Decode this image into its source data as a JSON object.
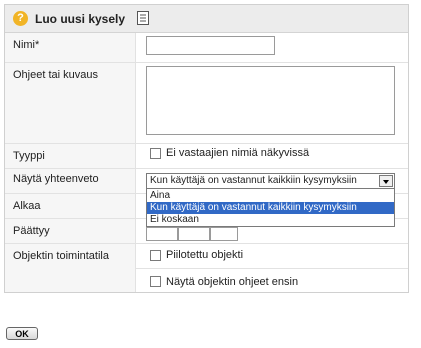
{
  "header": {
    "title": "Luo uusi kysely",
    "help_icon": "question-mark-icon",
    "edit_icon": "page-edit-icon"
  },
  "form": {
    "name_label": "Nimi*",
    "name_value": "",
    "description_label": "Ohjeet tai kuvaus",
    "description_value": "",
    "type_label": "Tyyppi",
    "type_checkbox_label": "Ei vastaajien nimiä näkyvissä",
    "summary_label": "Näytä yhteenveto",
    "summary_selected": "Kun käyttäjä on vastannut kaikkiin kysymyksiin",
    "summary_options": [
      "Aina",
      "Kun käyttäjä on vastannut kaikkiin kysymyksiin",
      "Ei koskaan"
    ],
    "start_label": "Alkaa",
    "end_label": "Päättyy",
    "mode_label": "Objektin toimintatila",
    "hidden_checkbox_label": "Piilotettu objekti",
    "show_instructions_label": "Näytä objektin ohjeet ensin"
  },
  "footer": {
    "ok_label": "OK"
  },
  "colors": {
    "header_bg": "#ececec",
    "highlight": "#3169c6",
    "help_icon": "#f1b426"
  }
}
